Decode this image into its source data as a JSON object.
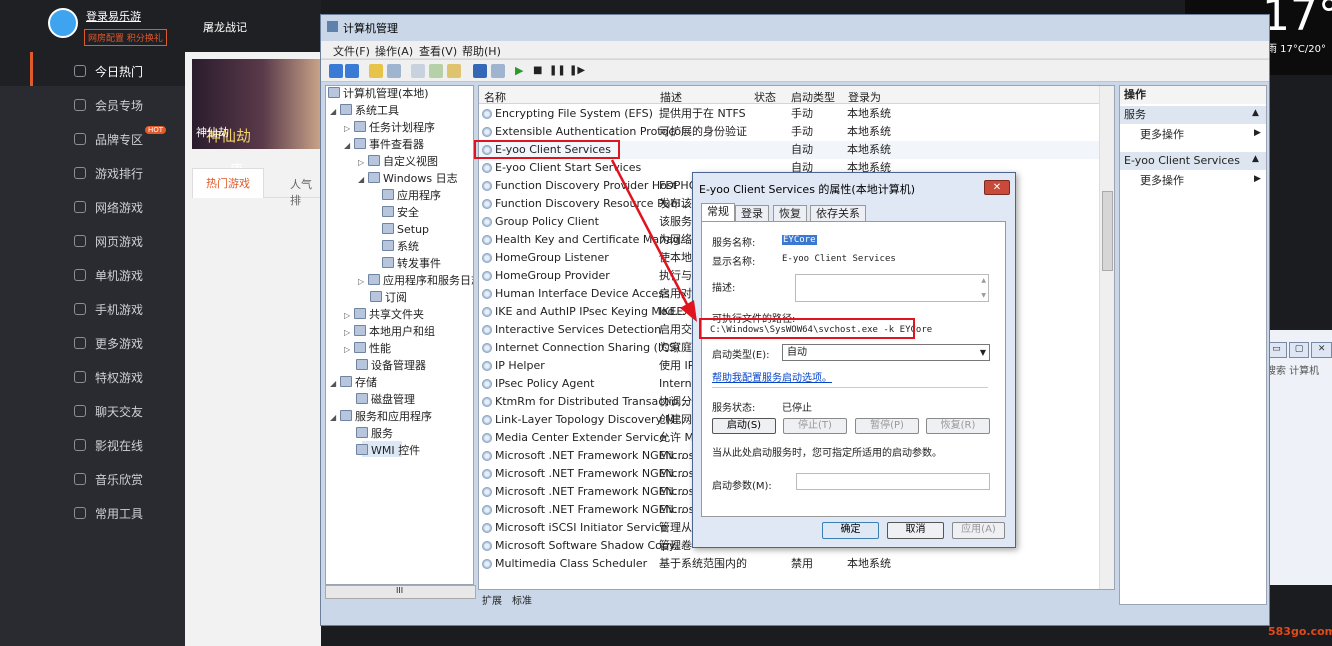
{
  "app": {
    "login": "登录易乐游",
    "promo": "网房配置 积分换礼",
    "tab_title": "屠龙战记",
    "banner_logo": "神仙劫",
    "banner_sub": "唐",
    "banner_name": "神仙劫",
    "game_tabs": [
      "热门游戏",
      "人气排"
    ],
    "nav": [
      {
        "label": "今日热门"
      },
      {
        "label": "会员专场"
      },
      {
        "label": "品牌专区",
        "badge": "HOT"
      },
      {
        "label": "游戏排行"
      },
      {
        "label": "网络游戏"
      },
      {
        "label": "网页游戏"
      },
      {
        "label": "单机游戏"
      },
      {
        "label": "手机游戏"
      },
      {
        "label": "更多游戏"
      },
      {
        "label": "特权游戏"
      },
      {
        "label": "聊天交友"
      },
      {
        "label": "影视在线"
      },
      {
        "label": "音乐欣赏"
      },
      {
        "label": "常用工具"
      }
    ]
  },
  "weather": {
    "temp": "17°C",
    "desc": "雨 17°C/20°"
  },
  "bgwin": {
    "search": "搜索 计算机"
  },
  "mmc": {
    "title": "计算机管理",
    "menu": [
      "文件(F)",
      "操作(A)",
      "查看(V)",
      "帮助(H)"
    ],
    "tree": [
      {
        "label": "计算机管理(本地)"
      },
      {
        "label": "系统工具"
      },
      {
        "label": "任务计划程序"
      },
      {
        "label": "事件查看器"
      },
      {
        "label": "自定义视图"
      },
      {
        "label": "Windows 日志"
      },
      {
        "label": "应用程序"
      },
      {
        "label": "安全"
      },
      {
        "label": "Setup"
      },
      {
        "label": "系统"
      },
      {
        "label": "转发事件"
      },
      {
        "label": "应用程序和服务日志"
      },
      {
        "label": "订阅"
      },
      {
        "label": "共享文件夹"
      },
      {
        "label": "本地用户和组"
      },
      {
        "label": "性能"
      },
      {
        "label": "设备管理器"
      },
      {
        "label": "存储"
      },
      {
        "label": "磁盘管理"
      },
      {
        "label": "服务和应用程序"
      },
      {
        "label": "服务"
      },
      {
        "label": "WMI 控件"
      }
    ],
    "hscroll_label": "III",
    "columns": [
      "名称",
      "描述",
      "状态",
      "启动类型",
      "登录为"
    ],
    "rows": [
      {
        "name": "Encrypting File System (EFS)",
        "desc": "提供用于在 NTFS ...",
        "status": "",
        "start": "手动",
        "logon": "本地系统"
      },
      {
        "name": "Extensible Authentication Protocol",
        "desc": "可扩展的身份验证...",
        "status": "",
        "start": "手动",
        "logon": "本地系统"
      },
      {
        "name": "E-yoo Client Services",
        "desc": "",
        "status": "",
        "start": "自动",
        "logon": "本地系统"
      },
      {
        "name": "E-yoo Client Start Services",
        "desc": "",
        "status": "",
        "start": "自动",
        "logon": "本地系统"
      },
      {
        "name": "Function Discovery Provider Host",
        "desc": "FDPHO",
        "status": "",
        "start": "",
        "logon": ""
      },
      {
        "name": "Function Discovery Resource Publ...",
        "desc": "发布该",
        "status": "",
        "start": "",
        "logon": ""
      },
      {
        "name": "Group Policy Client",
        "desc": "该服务",
        "status": "",
        "start": "",
        "logon": ""
      },
      {
        "name": "Health Key and Certificate Manag...",
        "desc": "为网络",
        "status": "",
        "start": "",
        "logon": ""
      },
      {
        "name": "HomeGroup Listener",
        "desc": "使本地",
        "status": "",
        "start": "",
        "logon": ""
      },
      {
        "name": "HomeGroup Provider",
        "desc": "执行与",
        "status": "",
        "start": "",
        "logon": ""
      },
      {
        "name": "Human Interface Device Access",
        "desc": "启用对",
        "status": "",
        "start": "",
        "logon": ""
      },
      {
        "name": "IKE and AuthIP IPsec Keying Mod...",
        "desc": "IKEEX",
        "status": "",
        "start": "",
        "logon": ""
      },
      {
        "name": "Interactive Services Detection",
        "desc": "启用交",
        "status": "",
        "start": "",
        "logon": ""
      },
      {
        "name": "Internet Connection Sharing (ICS)",
        "desc": "为家庭",
        "status": "",
        "start": "",
        "logon": ""
      },
      {
        "name": "IP Helper",
        "desc": "使用 IP",
        "status": "",
        "start": "",
        "logon": ""
      },
      {
        "name": "IPsec Policy Agent",
        "desc": "Interne",
        "status": "",
        "start": "",
        "logon": ""
      },
      {
        "name": "KtmRm for Distributed Transactio...",
        "desc": "协调分",
        "status": "",
        "start": "",
        "logon": ""
      },
      {
        "name": "Link-Layer Topology Discovery M...",
        "desc": "创建网",
        "status": "",
        "start": "",
        "logon": ""
      },
      {
        "name": "Media Center Extender Service",
        "desc": "允许 M",
        "status": "",
        "start": "",
        "logon": ""
      },
      {
        "name": "Microsoft .NET Framework NGEN...",
        "desc": "Micros",
        "status": "",
        "start": "",
        "logon": ""
      },
      {
        "name": "Microsoft .NET Framework NGEN...",
        "desc": "Micros",
        "status": "",
        "start": "",
        "logon": ""
      },
      {
        "name": "Microsoft .NET Framework NGEN...",
        "desc": "Micros",
        "status": "",
        "start": "",
        "logon": ""
      },
      {
        "name": "Microsoft .NET Framework NGEN...",
        "desc": "Micros",
        "status": "",
        "start": "",
        "logon": ""
      },
      {
        "name": "Microsoft iSCSI Initiator Service",
        "desc": "管理从",
        "status": "",
        "start": "",
        "logon": ""
      },
      {
        "name": "Microsoft Software Shadow Copy...",
        "desc": "管理卷",
        "status": "",
        "start": "",
        "logon": ""
      },
      {
        "name": "Multimedia Class Scheduler",
        "desc": "基于系统范围内的...",
        "status": "",
        "start": "禁用",
        "logon": "本地系统"
      }
    ],
    "bottom_tabs": [
      "扩展",
      "标准"
    ],
    "actions": {
      "header": "操作",
      "group1": "服务",
      "more1": "更多操作",
      "group2": "E-yoo Client Services",
      "more2": "更多操作"
    }
  },
  "dialog": {
    "title": "E-yoo Client Services 的属性(本地计算机)",
    "close": "✕",
    "tabs": [
      "常规",
      "登录",
      "恢复",
      "依存关系"
    ],
    "service_name_label": "服务名称:",
    "service_name": "EYCore",
    "display_name_label": "显示名称:",
    "display_name": "E-yoo Client Services",
    "desc_label": "描述:",
    "path_label": "可执行文件的路径:",
    "path": "C:\\Windows\\SysWOW64\\svchost.exe -k EYCore",
    "startup_label": "启动类型(E):",
    "startup_value": "自动",
    "help_link": "帮助我配置服务启动选项。",
    "status_label": "服务状态:",
    "status_value": "已停止",
    "btn_start": "启动(S)",
    "btn_stop": "停止(T)",
    "btn_pause": "暂停(P)",
    "btn_resume": "恢复(R)",
    "hint": "当从此处启动服务时，您可指定所适用的启动参数。",
    "param_label": "启动参数(M):",
    "ok": "确定",
    "cancel": "取消",
    "apply": "应用(A)"
  },
  "watermark": "583go.com",
  "colors": {
    "accent": "#e05a2b",
    "highlight": "#e0141e"
  }
}
